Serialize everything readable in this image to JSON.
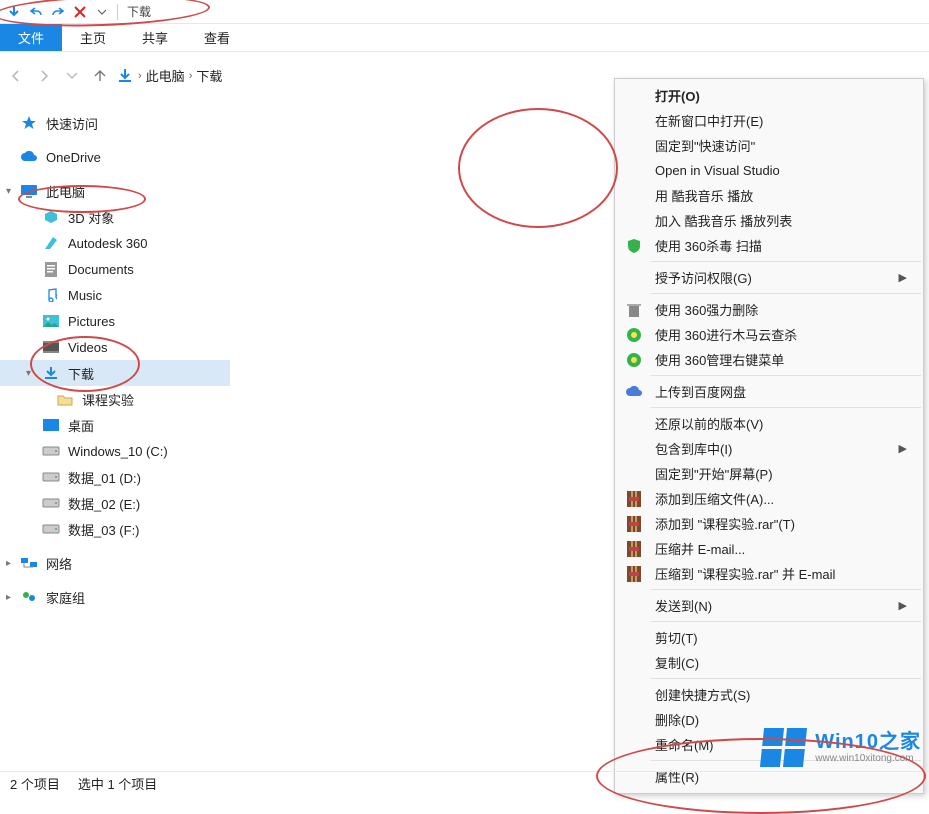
{
  "title": "下载",
  "ribbon": {
    "file": "文件",
    "home": "主页",
    "share": "共享",
    "view": "查看"
  },
  "breadcrumb": {
    "pc": "此电脑",
    "loc": "下载"
  },
  "sidebar": {
    "quick": "快速访问",
    "onedrive": "OneDrive",
    "thispc": "此电脑",
    "children": [
      {
        "label": "3D 对象"
      },
      {
        "label": "Autodesk 360"
      },
      {
        "label": "Documents"
      },
      {
        "label": "Music"
      },
      {
        "label": "Pictures"
      },
      {
        "label": "Videos"
      },
      {
        "label": "下载",
        "sel": true
      },
      {
        "label": "课程实验",
        "child": true
      },
      {
        "label": "桌面"
      },
      {
        "label": "Windows_10 (C:)"
      },
      {
        "label": "数据_01 (D:)"
      },
      {
        "label": "数据_02 (E:)"
      },
      {
        "label": "数据_03 (F:)"
      }
    ],
    "network": "网络",
    "homegroup": "家庭组"
  },
  "folder": {
    "name": "课程实验"
  },
  "menu": {
    "items": [
      {
        "label": "打开(O)",
        "bold": true
      },
      {
        "label": "在新窗口中打开(E)"
      },
      {
        "label": "固定到\"快速访问\""
      },
      {
        "label": "Open in Visual Studio"
      },
      {
        "label": "用 酷我音乐 播放"
      },
      {
        "label": "加入 酷我音乐 播放列表"
      },
      {
        "label": "使用 360杀毒 扫描",
        "icon": "shield"
      },
      {
        "sep": true
      },
      {
        "label": "授予访问权限(G)",
        "arrow": true
      },
      {
        "sep": true
      },
      {
        "label": "使用 360强力删除",
        "icon": "trash"
      },
      {
        "label": "使用 360进行木马云查杀",
        "icon": "360"
      },
      {
        "label": "使用 360管理右键菜单",
        "icon": "360"
      },
      {
        "sep": true
      },
      {
        "label": "上传到百度网盘",
        "icon": "cloud"
      },
      {
        "sep": true
      },
      {
        "label": "还原以前的版本(V)"
      },
      {
        "label": "包含到库中(I)",
        "arrow": true
      },
      {
        "label": "固定到\"开始\"屏幕(P)"
      },
      {
        "label": "添加到压缩文件(A)...",
        "icon": "rar"
      },
      {
        "label": "添加到 \"课程实验.rar\"(T)",
        "icon": "rar"
      },
      {
        "label": "压缩并 E-mail...",
        "icon": "rar"
      },
      {
        "label": "压缩到 \"课程实验.rar\" 并 E-mail",
        "icon": "rar"
      },
      {
        "sep": true
      },
      {
        "label": "发送到(N)",
        "arrow": true
      },
      {
        "sep": true
      },
      {
        "label": "剪切(T)"
      },
      {
        "label": "复制(C)"
      },
      {
        "sep": true
      },
      {
        "label": "创建快捷方式(S)"
      },
      {
        "label": "删除(D)"
      },
      {
        "label": "重命名(M)"
      },
      {
        "sep": true
      },
      {
        "label": "属性(R)"
      }
    ]
  },
  "status": {
    "count": "2 个项目",
    "sel": "选中 1 个项目"
  },
  "watermark": {
    "title": "Win10之家",
    "url": "www.win10xitong.com"
  }
}
